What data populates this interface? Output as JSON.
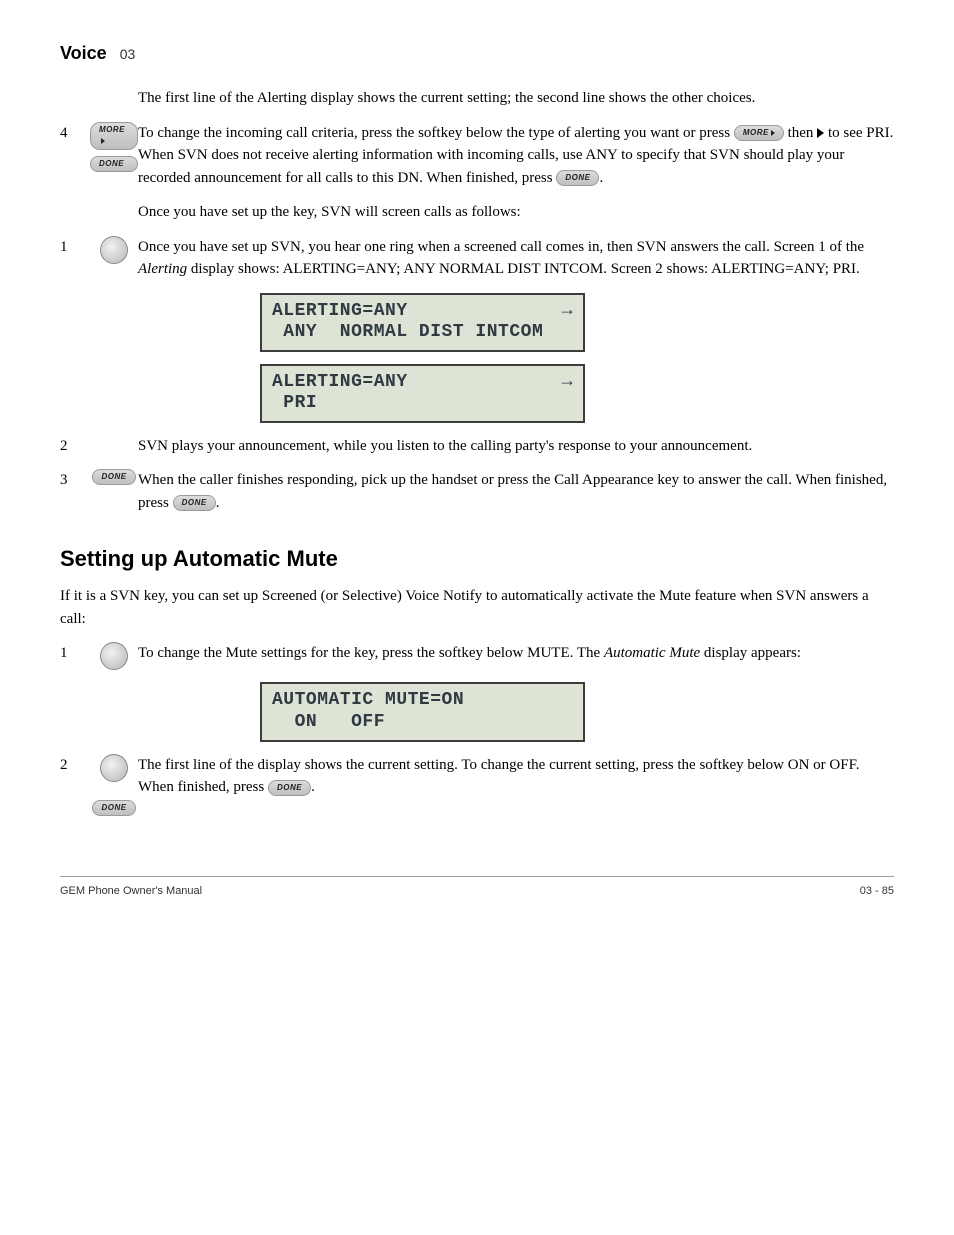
{
  "header": {
    "title": "Voice",
    "chapter": "03"
  },
  "alerting_section": {
    "p1": "The first line of the Alerting display shows the current setting; the second line shows the other choices.",
    "step4": {
      "num": "4",
      "more_label": "MORE",
      "done_label": "DONE",
      "text_a": "To change the incoming call criteria, press the softkey below the type of alerting you want or press ",
      "text_b": " then  ",
      "text_c": " to see PRI. When SVN does not receive alerting information with incoming calls, use ANY to specify that SVN should play your recorded announcement for all calls to this DN. When finished, press ",
      "text_d": "."
    }
  },
  "setup_section": {
    "intro": "Once you have set up the key, SVN will screen calls as follows:",
    "step1": {
      "num": "1",
      "text_a": "Once you have set up SVN, you hear one ring when a screened call comes in, then SVN answers the call. Screen 1 of the ",
      "i1": "Alerting",
      "text_b": " display shows: ALERTING=ANY; ANY   NORMAL   DIST   INTCOM. Screen 2 shows: ALERTING=ANY; PRI."
    },
    "lcd1": {
      "line1": "ALERTING=ANY",
      "line2": " ANY  NORMAL DIST INTCOM",
      "arrow": "→"
    },
    "lcd2": {
      "line1": "ALERTING=ANY",
      "line2": " PRI",
      "arrow": "→"
    },
    "step2": {
      "num": "2",
      "text": "SVN plays your announcement, while you listen to the calling party's response to your announcement."
    },
    "step3": {
      "num": "3",
      "done_label": "DONE",
      "text_a": "When the caller finishes responding, pick up the handset or press the Call Appearance key to answer the call. When finished, press ",
      "text_b": "."
    }
  },
  "automute_section": {
    "title": "Setting up Automatic Mute",
    "intro": "If it is a SVN key, you can set up Screened (or Selective) Voice Notify to automatically activate the Mute feature when SVN answers a call:",
    "step1": {
      "num": "1",
      "text_a": "To change the Mute settings for the key, press the softkey below MUTE. The ",
      "i1": "Automatic Mute",
      "text_b": " display appears:"
    },
    "lcd": {
      "line1": "AUTOMATIC MUTE=ON",
      "line2": "  ON   OFF"
    },
    "step2": {
      "num": "2",
      "done_label": "DONE",
      "text_a": "The first line of the display shows the current setting. To change the current setting, press the softkey below ON or OFF. When finished, press ",
      "text_b": "."
    }
  },
  "footer": {
    "left": "GEM Phone Owner's Manual",
    "right": "03 - 85"
  }
}
